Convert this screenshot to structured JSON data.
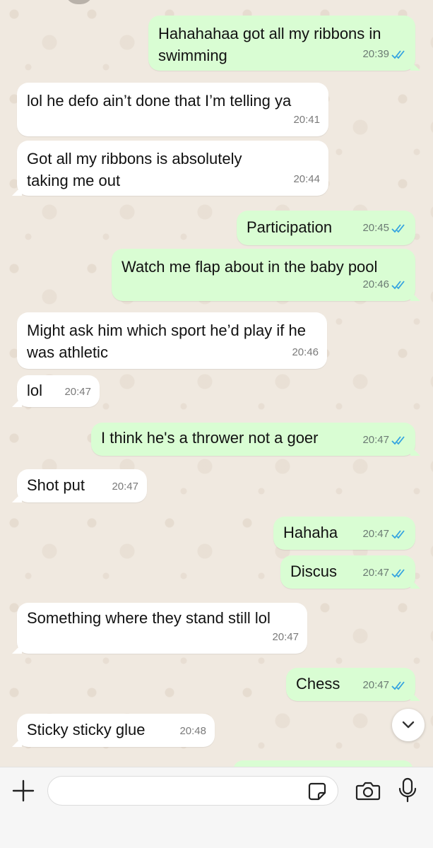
{
  "messages": [
    {
      "dir": "out",
      "text": "Hahahahaa got all my ribbons in swimming",
      "time": "20:39",
      "read": true
    },
    {
      "dir": "in",
      "text": "lol he defo ain’t done that I’m telling ya",
      "time": "20:41"
    },
    {
      "dir": "in",
      "text": "Got all my ribbons is absolutely taking me out",
      "time": "20:44"
    },
    {
      "dir": "out",
      "text": "Participation",
      "time": "20:45",
      "read": true
    },
    {
      "dir": "out",
      "text": "Watch me flap about in the baby pool",
      "time": "20:46",
      "read": true
    },
    {
      "dir": "in",
      "text": "Might ask him which sport he’d play if he was athletic",
      "time": "20:46"
    },
    {
      "dir": "in",
      "text": "lol",
      "time": "20:47"
    },
    {
      "dir": "out",
      "text": "I think he's a thrower not a goer",
      "time": "20:47",
      "read": true
    },
    {
      "dir": "in",
      "text": "Shot put",
      "time": "20:47"
    },
    {
      "dir": "out",
      "text": "Hahaha",
      "time": "20:47",
      "read": true
    },
    {
      "dir": "out",
      "text": "Discus",
      "time": "20:47",
      "read": true
    },
    {
      "dir": "in",
      "text": "Something where they stand still lol",
      "time": "20:47"
    },
    {
      "dir": "out",
      "text": "Chess",
      "time": "20:47",
      "read": true
    },
    {
      "dir": "in",
      "text": "Sticky sticky glue",
      "time": "20:48"
    }
  ],
  "colors": {
    "outgoing_bubble": "#d9fdd3",
    "incoming_bubble": "#ffffff",
    "read_tick": "#34a3e0",
    "wallpaper": "#f0e9e0"
  },
  "composer": {
    "icons": [
      "plus-icon",
      "sticker-icon",
      "camera-icon",
      "mic-icon"
    ],
    "scroll_button_icon": "chevron-down-icon"
  }
}
